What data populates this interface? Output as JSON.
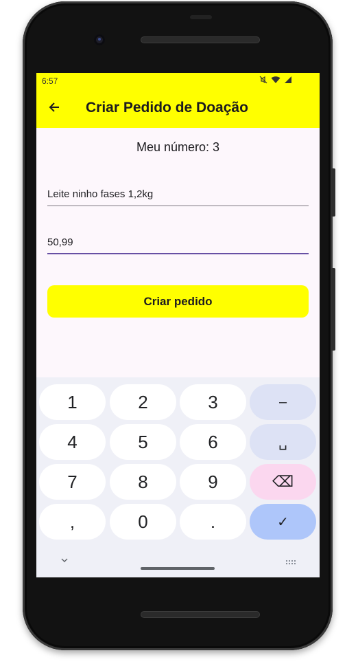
{
  "status_bar": {
    "time": "6:57",
    "icons": [
      "mute-icon",
      "wifi-icon",
      "signal-icon"
    ]
  },
  "app_bar": {
    "title": "Criar Pedido de Doação",
    "back_icon": "arrow-left-icon"
  },
  "form": {
    "heading": "Meu número: 3",
    "description_value": "Leite ninho fases 1,2kg",
    "value_value": "50,99",
    "submit_label": "Criar pedido"
  },
  "keyboard": {
    "rows": [
      [
        "1",
        "2",
        "3",
        "–"
      ],
      [
        "4",
        "5",
        "6",
        "␣"
      ],
      [
        "7",
        "8",
        "9",
        "⌫"
      ],
      [
        ",",
        "0",
        ".",
        "✓"
      ]
    ],
    "hide_icon": "chevron-down-icon",
    "switch_icon": "keyboard-icon"
  },
  "colors": {
    "accent": "#ffff00",
    "focus": "#6750a4",
    "background": "#fdf7fc",
    "keyboard_bg": "#eff0f7"
  }
}
